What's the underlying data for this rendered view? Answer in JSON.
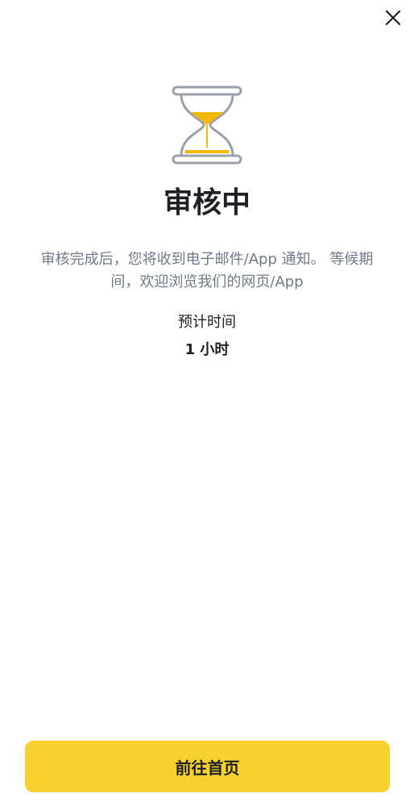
{
  "header": {
    "close_icon": "close-icon"
  },
  "status": {
    "icon": "hourglass-icon",
    "title": "审核中",
    "description": "审核完成后，您将收到电子邮件/App 通知。 等候期间，欢迎浏览我们的网页/App",
    "eta_label": "预计时间",
    "eta_value": "1 小时"
  },
  "footer": {
    "primary_button_label": "前往首页"
  },
  "colors": {
    "accent": "#f8d12f",
    "sand": "#f0b90b",
    "text_primary": "#1e2026",
    "text_secondary": "#707a8a",
    "outline": "#9aa1ab"
  }
}
